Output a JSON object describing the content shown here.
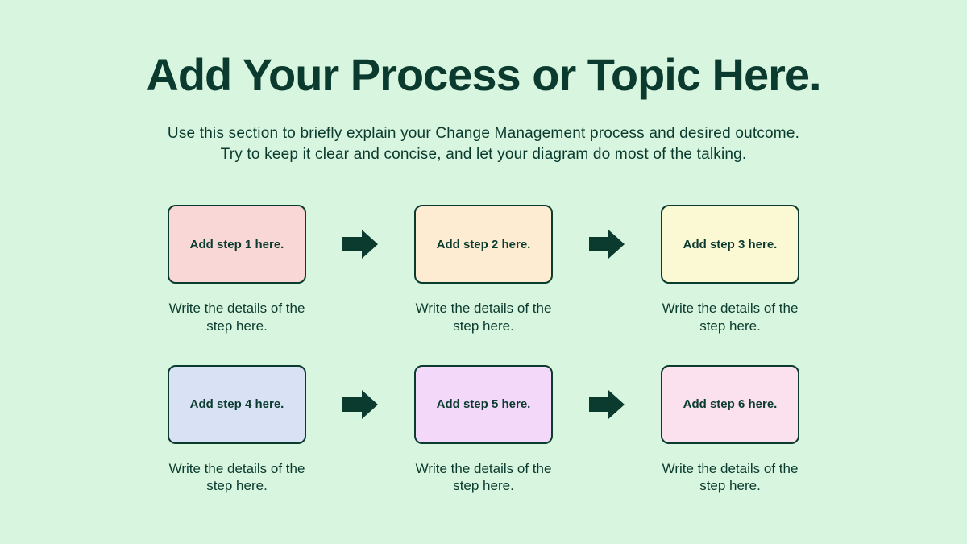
{
  "title": "Add Your Process or Topic Here.",
  "subtitle_line1": "Use this section to briefly explain your Change Management process and desired outcome.",
  "subtitle_line2": "Try to keep it clear and concise, and let your diagram do most of the talking.",
  "colors": {
    "arrow": "#0a3b2e",
    "border": "#0a3b2e",
    "step1": "#f9d7d6",
    "step2": "#fdebd2",
    "step3": "#fbf8d4",
    "step4": "#d9e1f4",
    "step5": "#f3d8fa",
    "step6": "#fbe0ee"
  },
  "steps": [
    {
      "label": "Add step 1 here.",
      "detail": "Write the details of the step here."
    },
    {
      "label": "Add step 2 here.",
      "detail": "Write the details of the step here."
    },
    {
      "label": "Add step 3 here.",
      "detail": "Write the details of the step here."
    },
    {
      "label": "Add step 4 here.",
      "detail": "Write the details of the step here."
    },
    {
      "label": "Add step 5 here.",
      "detail": "Write the details of the step here."
    },
    {
      "label": "Add step 6 here.",
      "detail": "Write the details of the step here."
    }
  ]
}
